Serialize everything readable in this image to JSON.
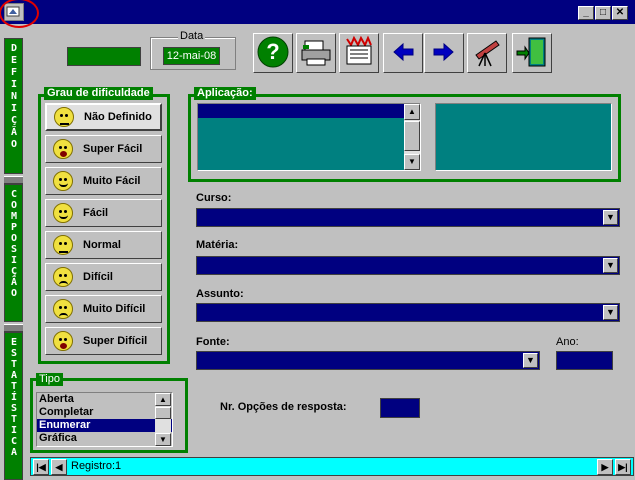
{
  "window": {
    "icon": "app-icon",
    "buttons": {
      "minimize": "_",
      "maximize": "□",
      "close": "✕"
    }
  },
  "sidebar": {
    "tabs": [
      {
        "label": "DEFINIÇÃO"
      },
      {
        "label": "COMPOSIÇÃO"
      },
      {
        "label": "ESTATÍSTICA"
      }
    ]
  },
  "header": {
    "data_label": "Data",
    "data_value": "12-mai-08"
  },
  "toolbar": {
    "buttons": [
      {
        "icon": "help-icon"
      },
      {
        "icon": "printer-icon"
      },
      {
        "icon": "shredder-icon"
      },
      {
        "icon": "arrow-left-icon"
      },
      {
        "icon": "arrow-right-icon"
      },
      {
        "icon": "telescope-icon"
      },
      {
        "icon": "exit-door-icon"
      }
    ]
  },
  "difficulty": {
    "title": "Grau de dificuldade",
    "items": [
      {
        "label": "Não Definido",
        "face": "neutral"
      },
      {
        "label": "Super Fácil",
        "face": "grin"
      },
      {
        "label": "Muito Fácil",
        "face": "wink"
      },
      {
        "label": "Fácil",
        "face": "smile"
      },
      {
        "label": "Normal",
        "face": "neutral"
      },
      {
        "label": "Difícil",
        "face": "sad"
      },
      {
        "label": "Muito Difícil",
        "face": "sad"
      },
      {
        "label": "Super Difícil",
        "face": "scream"
      }
    ]
  },
  "aplicacao": {
    "title": "Aplicação:"
  },
  "form": {
    "curso_label": "Curso:",
    "materia_label": "Matéria:",
    "assunto_label": "Assunto:",
    "fonte_label": "Fonte:",
    "ano_label": "Ano:",
    "opcoes_label": "Nr. Opções de resposta:"
  },
  "tipo": {
    "title": "Tipo",
    "items": [
      "Aberta",
      "Completar",
      "Enumerar",
      "Gráfica"
    ],
    "selected": "Enumerar"
  },
  "status": {
    "registro": "Registro:1"
  },
  "colors": {
    "accent_green": "#008000",
    "navy": "#000080",
    "teal": "#008080",
    "status_cyan": "#00ffff"
  }
}
